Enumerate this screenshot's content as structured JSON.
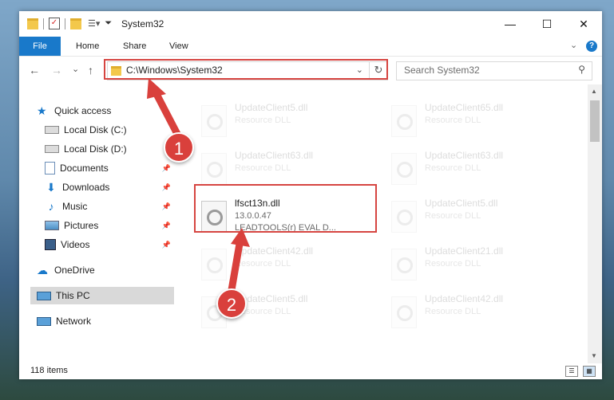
{
  "window": {
    "title": "System32",
    "minimize": "—",
    "maximize": "☐",
    "close": "✕"
  },
  "ribbon": {
    "tabs": [
      "File",
      "Home",
      "Share",
      "View"
    ],
    "collapse": "⌄",
    "help": "?"
  },
  "nav": {
    "back": "←",
    "forward": "→",
    "recent": "⌄",
    "up": "↑",
    "address": "C:\\Windows\\System32",
    "address_dropdown": "⌄",
    "refresh": "↻",
    "search_placeholder": "Search System32",
    "search_icon": "⚲"
  },
  "sidebar": {
    "items": [
      {
        "label": "Quick access",
        "icon": "star-icon"
      },
      {
        "label": "Local Disk (C:)",
        "icon": "drive-icon"
      },
      {
        "label": "Local Disk (D:)",
        "icon": "drive-icon"
      },
      {
        "label": "Documents",
        "icon": "documents-icon"
      },
      {
        "label": "Downloads",
        "icon": "download-icon"
      },
      {
        "label": "Music",
        "icon": "music-icon"
      },
      {
        "label": "Pictures",
        "icon": "pictures-icon"
      },
      {
        "label": "Videos",
        "icon": "videos-icon"
      },
      {
        "label": "OneDrive",
        "icon": "cloud-icon"
      },
      {
        "label": "This PC",
        "icon": "computer-icon"
      },
      {
        "label": "Network",
        "icon": "network-icon"
      }
    ],
    "pin": "📌"
  },
  "files": {
    "left": [
      {
        "name": "UpdateClient5.dll",
        "type": "Resource DLL"
      },
      {
        "name": "UpdateClient63.dll",
        "type": "Resource DLL"
      },
      {
        "name": "lfsct13n.dll",
        "version": "13.0.0.47",
        "desc": "LEADTOOLS(r) EVAL D..."
      },
      {
        "name": "UpdateClient42.dll",
        "type": "Resource DLL"
      },
      {
        "name": "UpdateClient5.dll",
        "type": "Resource DLL"
      }
    ],
    "right": [
      {
        "name": "UpdateClient65.dll",
        "type": "Resource DLL"
      },
      {
        "name": "UpdateClient63.dll",
        "type": "Resource DLL"
      },
      {
        "name": "UpdateClient5.dll",
        "type": "Resource DLL"
      },
      {
        "name": "UpdateClient21.dll",
        "type": "Resource DLL"
      },
      {
        "name": "UpdateClient42.dll",
        "type": "Resource DLL"
      }
    ]
  },
  "status": {
    "count": "118 items"
  },
  "annotations": {
    "step1": "1",
    "step2": "2"
  },
  "colors": {
    "accent": "#1979ca",
    "highlight": "#d64541",
    "selected": "#d9d9d9"
  }
}
